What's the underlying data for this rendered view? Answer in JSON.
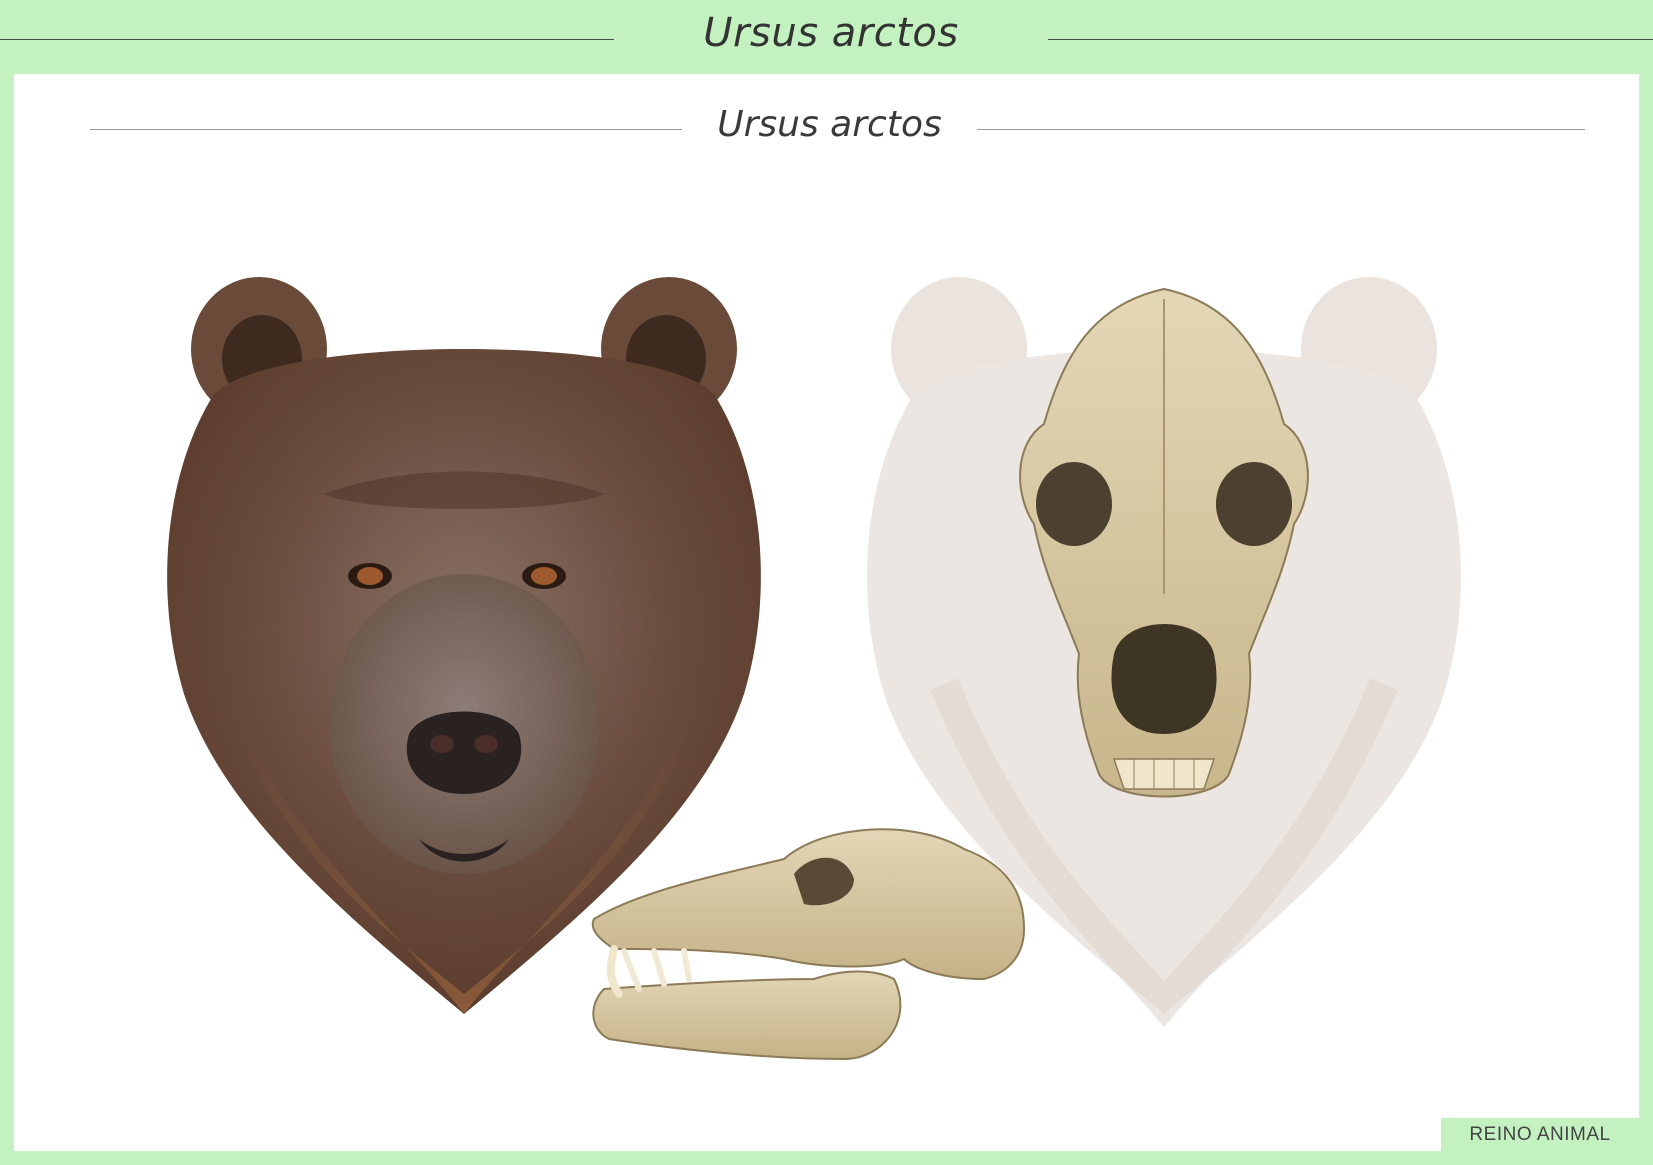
{
  "header": {
    "title": "Ursus arctos"
  },
  "plate": {
    "title": "Ursus arctos"
  },
  "footer": {
    "badge": "REINO ANIMAL"
  },
  "colors": {
    "frame_green": "#c3f2c0",
    "fur_brown": "#6b4b3a",
    "fur_light": "#e6e0dc",
    "bone": "#d9cba6"
  }
}
